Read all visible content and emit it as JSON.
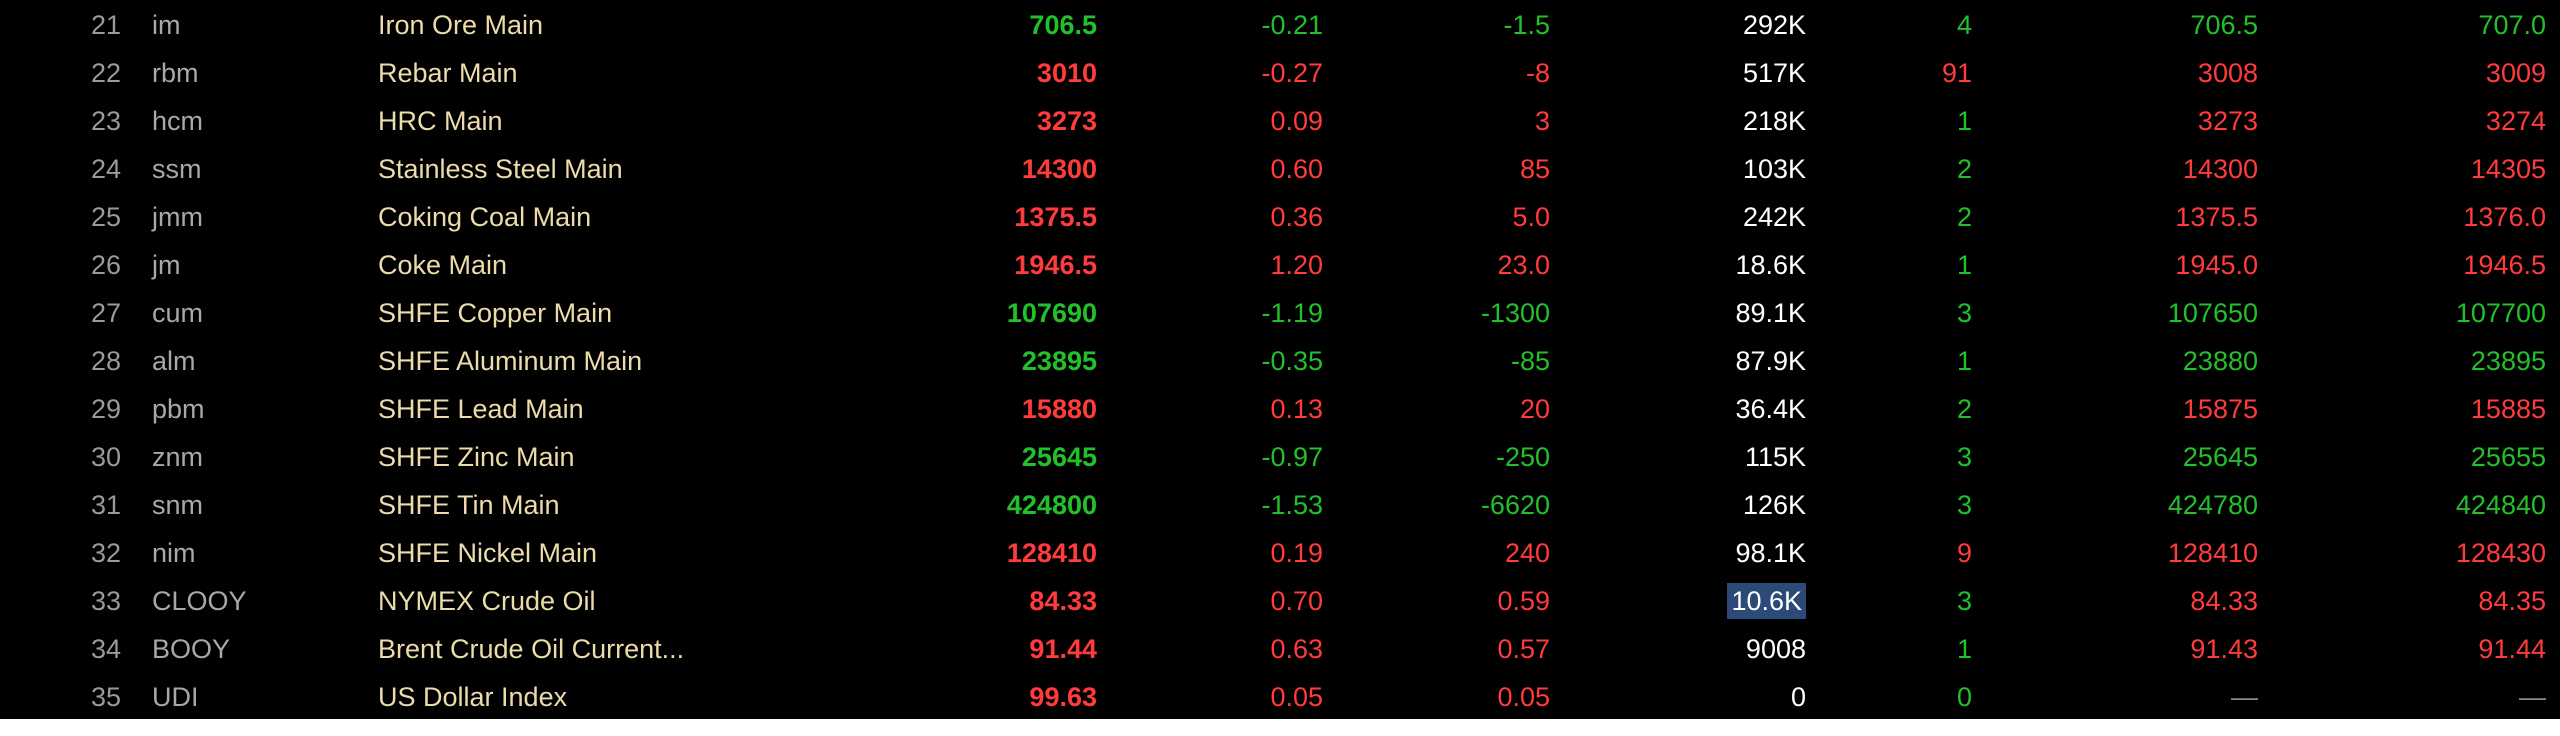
{
  "colors": {
    "up": "#ff3b3b",
    "down": "#22c02a",
    "name": "#ecdcaa",
    "highlight": "#2b4a78",
    "background": "#000000"
  },
  "rows": [
    {
      "idx": "21",
      "code": "im",
      "name": "Iron Ore Main",
      "last": "706.5",
      "pct": "-0.21",
      "chg": "-1.5",
      "vol": "292K",
      "cnt": "4",
      "bid": "706.5",
      "ask": "707.0",
      "dir": "down",
      "cnt_dir": "down",
      "bid_dir": "down",
      "ask_dir": "down"
    },
    {
      "idx": "22",
      "code": "rbm",
      "name": "Rebar Main",
      "last": "3010",
      "pct": "-0.27",
      "chg": "-8",
      "vol": "517K",
      "cnt": "91",
      "bid": "3008",
      "ask": "3009",
      "dir": "up",
      "pct_dir": "up",
      "chg_dir": "up",
      "cnt_dir": "up",
      "bid_dir": "up",
      "ask_dir": "up"
    },
    {
      "idx": "23",
      "code": "hcm",
      "name": "HRC Main",
      "last": "3273",
      "pct": "0.09",
      "chg": "3",
      "vol": "218K",
      "cnt": "1",
      "bid": "3273",
      "ask": "3274",
      "dir": "up",
      "cnt_dir": "down",
      "bid_dir": "up",
      "ask_dir": "up"
    },
    {
      "idx": "24",
      "code": "ssm",
      "name": "Stainless Steel Main",
      "last": "14300",
      "pct": "0.60",
      "chg": "85",
      "vol": "103K",
      "cnt": "2",
      "bid": "14300",
      "ask": "14305",
      "dir": "up",
      "cnt_dir": "down",
      "bid_dir": "up",
      "ask_dir": "up"
    },
    {
      "idx": "25",
      "code": "jmm",
      "name": "Coking Coal Main",
      "last": "1375.5",
      "pct": "0.36",
      "chg": "5.0",
      "vol": "242K",
      "cnt": "2",
      "bid": "1375.5",
      "ask": "1376.0",
      "dir": "up",
      "cnt_dir": "down",
      "bid_dir": "up",
      "ask_dir": "up"
    },
    {
      "idx": "26",
      "code": "jm",
      "name": "Coke Main",
      "last": "1946.5",
      "pct": "1.20",
      "chg": "23.0",
      "vol": "18.6K",
      "cnt": "1",
      "bid": "1945.0",
      "ask": "1946.5",
      "dir": "up",
      "cnt_dir": "down",
      "bid_dir": "up",
      "ask_dir": "up"
    },
    {
      "idx": "27",
      "code": "cum",
      "name": "SHFE Copper Main",
      "last": "107690",
      "pct": "-1.19",
      "chg": "-1300",
      "vol": "89.1K",
      "cnt": "3",
      "bid": "107650",
      "ask": "107700",
      "dir": "down",
      "cnt_dir": "down",
      "bid_dir": "down",
      "ask_dir": "down"
    },
    {
      "idx": "28",
      "code": "alm",
      "name": "SHFE Aluminum Main",
      "last": "23895",
      "pct": "-0.35",
      "chg": "-85",
      "vol": "87.9K",
      "cnt": "1",
      "bid": "23880",
      "ask": "23895",
      "dir": "down",
      "cnt_dir": "down",
      "bid_dir": "down",
      "ask_dir": "down"
    },
    {
      "idx": "29",
      "code": "pbm",
      "name": "SHFE Lead Main",
      "last": "15880",
      "pct": "0.13",
      "chg": "20",
      "vol": "36.4K",
      "cnt": "2",
      "bid": "15875",
      "ask": "15885",
      "dir": "up",
      "cnt_dir": "down",
      "bid_dir": "up",
      "ask_dir": "up"
    },
    {
      "idx": "30",
      "code": "znm",
      "name": "SHFE Zinc Main",
      "last": "25645",
      "pct": "-0.97",
      "chg": "-250",
      "vol": "115K",
      "cnt": "3",
      "bid": "25645",
      "ask": "25655",
      "dir": "down",
      "cnt_dir": "down",
      "bid_dir": "down",
      "ask_dir": "down"
    },
    {
      "idx": "31",
      "code": "snm",
      "name": "SHFE Tin Main",
      "last": "424800",
      "pct": "-1.53",
      "chg": "-6620",
      "vol": "126K",
      "cnt": "3",
      "bid": "424780",
      "ask": "424840",
      "dir": "down",
      "cnt_dir": "down",
      "bid_dir": "down",
      "ask_dir": "down"
    },
    {
      "idx": "32",
      "code": "nim",
      "name": "SHFE Nickel Main",
      "last": "128410",
      "pct": "0.19",
      "chg": "240",
      "vol": "98.1K",
      "cnt": "9",
      "bid": "128410",
      "ask": "128430",
      "dir": "up",
      "cnt_dir": "up",
      "bid_dir": "up",
      "ask_dir": "up"
    },
    {
      "idx": "33",
      "code": "CLOOY",
      "name": "NYMEX Crude Oil",
      "last": "84.33",
      "pct": "0.70",
      "chg": "0.59",
      "vol": "10.6K",
      "cnt": "3",
      "bid": "84.33",
      "ask": "84.35",
      "dir": "up",
      "cnt_dir": "down",
      "bid_dir": "up",
      "ask_dir": "up",
      "vol_highlight": true
    },
    {
      "idx": "34",
      "code": "BOOY",
      "name": "Brent Crude Oil Current...",
      "last": "91.44",
      "pct": "0.63",
      "chg": "0.57",
      "vol": "9008",
      "cnt": "1",
      "bid": "91.43",
      "ask": "91.44",
      "dir": "up",
      "cnt_dir": "down",
      "bid_dir": "up",
      "ask_dir": "up"
    },
    {
      "idx": "35",
      "code": "UDI",
      "name": "US Dollar Index",
      "last": "99.63",
      "pct": "0.05",
      "chg": "0.05",
      "vol": "0",
      "cnt": "0",
      "bid": "—",
      "ask": "—",
      "dir": "up",
      "cnt_dir": "down",
      "bid_dir": "none",
      "ask_dir": "none"
    }
  ]
}
